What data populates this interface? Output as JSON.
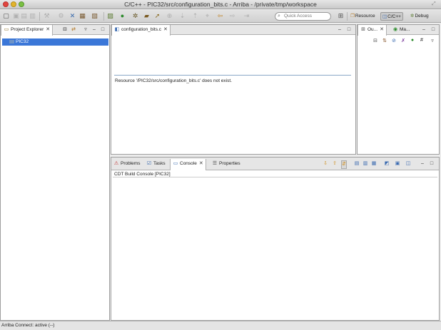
{
  "window": {
    "title": "C/C++ - PIC32/src/configuration_bits.c - Arriba - /private/tmp/workspace"
  },
  "toolbar": {
    "quick_access_placeholder": "Quick Access",
    "perspectives": [
      {
        "label": "Resource",
        "icon": "resource-perspective-icon"
      },
      {
        "label": "C/C++",
        "icon": "cpp-perspective-icon",
        "active": true
      },
      {
        "label": "Debug",
        "icon": "debug-perspective-icon"
      }
    ]
  },
  "project_explorer": {
    "tab_label": "Project Explorer",
    "items": [
      {
        "label": "PIC32",
        "selected": true
      }
    ]
  },
  "editor": {
    "tab_label": "configuration_bits.c",
    "message": "Resource '/PIC32/src/configuration_bits.c' does not exist."
  },
  "outline": {
    "tabs": [
      {
        "label": "Ou..."
      },
      {
        "label": "Ma..."
      }
    ]
  },
  "bottom_panel": {
    "tabs": [
      {
        "label": "Problems"
      },
      {
        "label": "Tasks"
      },
      {
        "label": "Console",
        "active": true
      },
      {
        "label": "Properties"
      }
    ],
    "console_title": "CDT Build Console [PIC32]"
  },
  "status_bar": {
    "text": "Arriba Connect: active (--)"
  },
  "colors": {
    "selection": "#3b77d8",
    "separator_line": "#8aa8c8"
  }
}
